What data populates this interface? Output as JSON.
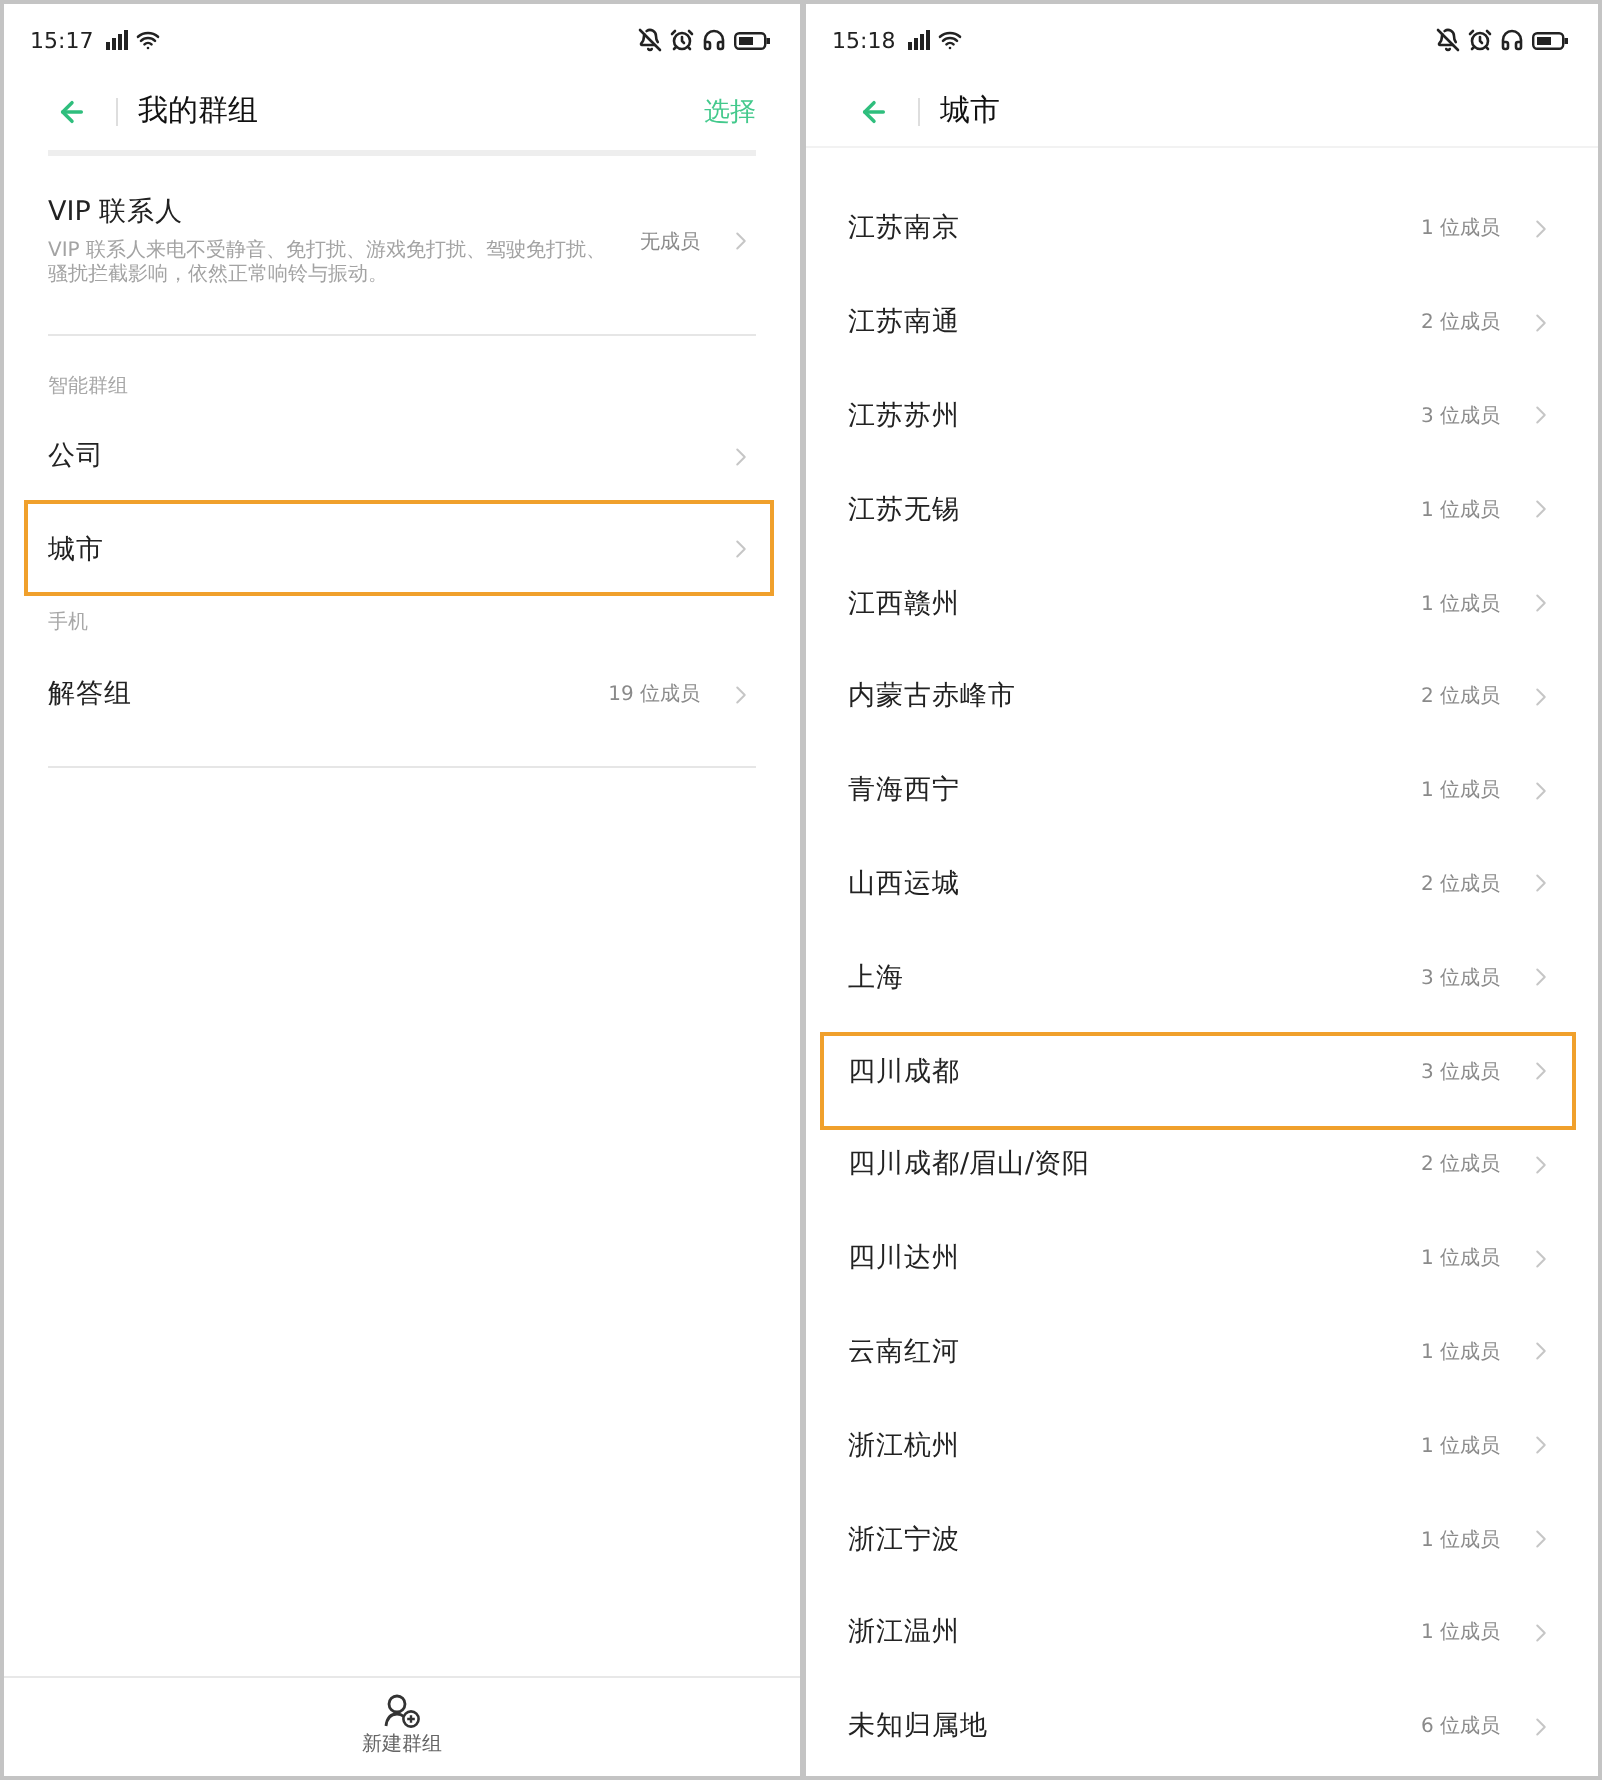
{
  "left_screen": {
    "status_bar": {
      "time": "15:17"
    },
    "header": {
      "title": "我的群组",
      "action": "选择"
    },
    "vip": {
      "title": "VIP 联系人",
      "description": "VIP 联系人来电不受静音、免打扰、游戏免打扰、驾驶免打扰、骚扰拦截影响，依然正常响铃与振动。",
      "count": "无成员"
    },
    "sections": [
      {
        "heading": "智能群组",
        "items": [
          {
            "name": "公司",
            "highlighted": false
          },
          {
            "name": "城市",
            "highlighted": true
          }
        ]
      },
      {
        "heading": "手机",
        "items": [
          {
            "name": "解答组",
            "count": "19 位成员",
            "highlighted": false
          }
        ]
      }
    ],
    "bottom_bar": {
      "label": "新建群组"
    }
  },
  "right_screen": {
    "status_bar": {
      "time": "15:18"
    },
    "header": {
      "title": "城市"
    },
    "items": [
      {
        "name": "江苏南京",
        "count": "1 位成员",
        "highlighted": false
      },
      {
        "name": "江苏南通",
        "count": "2 位成员",
        "highlighted": false
      },
      {
        "name": "江苏苏州",
        "count": "3 位成员",
        "highlighted": false
      },
      {
        "name": "江苏无锡",
        "count": "1 位成员",
        "highlighted": false
      },
      {
        "name": "江西赣州",
        "count": "1 位成员",
        "highlighted": false
      },
      {
        "name": "内蒙古赤峰市",
        "count": "2 位成员",
        "highlighted": false
      },
      {
        "name": "青海西宁",
        "count": "1 位成员",
        "highlighted": false
      },
      {
        "name": "山西运城",
        "count": "2 位成员",
        "highlighted": false
      },
      {
        "name": "上海",
        "count": "3 位成员",
        "highlighted": false
      },
      {
        "name": "四川成都",
        "count": "3 位成员",
        "highlighted": true
      },
      {
        "name": "四川成都/眉山/资阳",
        "count": "2 位成员",
        "highlighted": false
      },
      {
        "name": "四川达州",
        "count": "1 位成员",
        "highlighted": false
      },
      {
        "name": "云南红河",
        "count": "1 位成员",
        "highlighted": false
      },
      {
        "name": "浙江杭州",
        "count": "1 位成员",
        "highlighted": false
      },
      {
        "name": "浙江宁波",
        "count": "1 位成员",
        "highlighted": false
      },
      {
        "name": "浙江温州",
        "count": "1 位成员",
        "highlighted": false
      },
      {
        "name": "未知归属地",
        "count": "6 位成员",
        "highlighted": false
      }
    ]
  }
}
